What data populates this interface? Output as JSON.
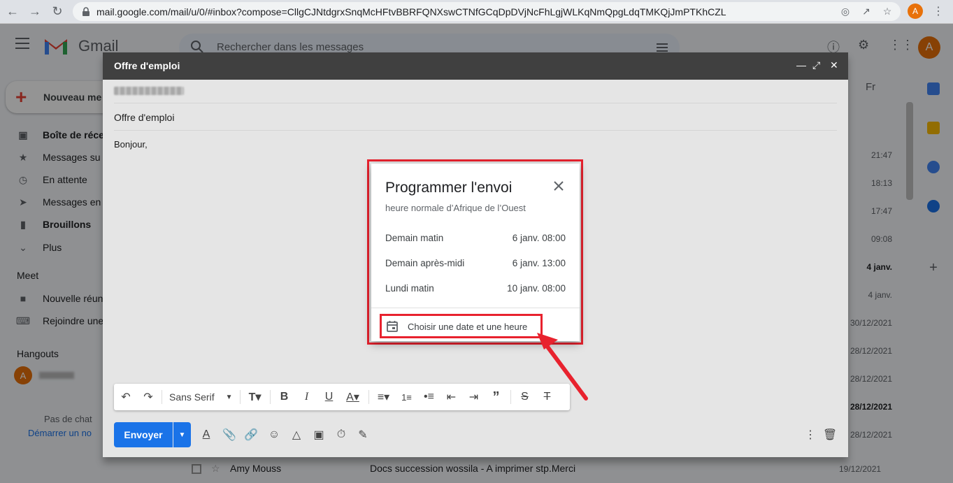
{
  "browser": {
    "url": "mail.google.com/mail/u/0/#inbox?compose=CllgCJNtdgrxSnqMcHFtvBBRFQNXswCTNfGCqDpDVjNcFhLgjWLKqNmQpgLdqTMKQjJmPTKhCZL",
    "profile_initial": "A"
  },
  "gmail": {
    "logo_text": "Gmail",
    "search_placeholder": "Rechercher dans les messages",
    "avatar_initial": "A",
    "compose_label": "Nouveau me",
    "sidebar": [
      {
        "label": "Boîte de réce",
        "icon": "inbox-icon",
        "bold": true
      },
      {
        "label": "Messages su",
        "icon": "star-icon",
        "bold": false
      },
      {
        "label": "En attente",
        "icon": "clock-icon",
        "bold": false
      },
      {
        "label": "Messages en",
        "icon": "send-icon",
        "bold": false
      },
      {
        "label": "Brouillons",
        "icon": "draft-icon",
        "bold": true
      },
      {
        "label": "Plus",
        "icon": "chevron-down-icon",
        "bold": false
      }
    ],
    "meet_section": "Meet",
    "meet_items": [
      {
        "label": "Nouvelle réun",
        "icon": "video-icon"
      },
      {
        "label": "Rejoindre une",
        "icon": "keyboard-icon"
      }
    ],
    "hangouts_section": "Hangouts",
    "hangouts_avatar": "A",
    "footer_text": "Pas de chat",
    "footer_link": "Démarrer un no",
    "lang_label": "Fr",
    "mail_times": [
      "21:47",
      "18:13",
      "17:47",
      "09:08",
      "4 janv.",
      "4 janv.",
      "30/12/2021",
      "28/12/2021",
      "28/12/2021",
      "28/12/2021",
      "28/12/2021",
      "19/12/2021",
      "19/12/2021"
    ],
    "last_row": {
      "sender": "Amy Mouss",
      "subject": "Docs succession wossila - A imprimer stp.Merci",
      "date": "19/12/2021"
    }
  },
  "compose": {
    "window_title": "Offre d'emploi",
    "subject": "Offre d'emploi",
    "body": "Bonjour,",
    "font_name": "Sans Serif",
    "send_label": "Envoyer"
  },
  "schedule_dialog": {
    "title": "Programmer l'envoi",
    "timezone": "heure normale d’Afrique de l’Ouest",
    "options": [
      {
        "label": "Demain matin",
        "value": "6 janv. 08:00"
      },
      {
        "label": "Demain après-midi",
        "value": "6 janv. 13:00"
      },
      {
        "label": "Lundi matin",
        "value": "10 janv. 08:00"
      }
    ],
    "custom_label": "Choisir une date et une heure"
  },
  "colors": {
    "highlight": "#e8222e",
    "send_blue": "#1a73e8",
    "compose_header": "#404040"
  }
}
